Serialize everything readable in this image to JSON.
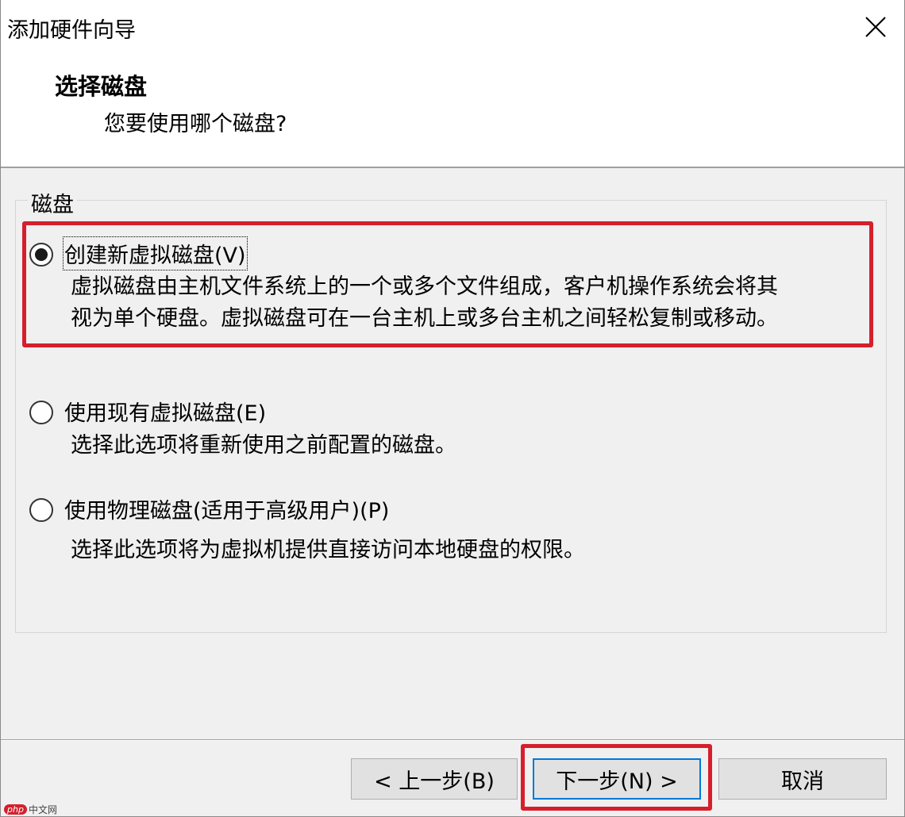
{
  "window": {
    "title": "添加硬件向导"
  },
  "header": {
    "title": "选择磁盘",
    "subtitle": "您要使用哪个磁盘?"
  },
  "group": {
    "label": "磁盘"
  },
  "options": [
    {
      "label": "创建新虚拟磁盘(V)",
      "checked": true,
      "desc_lines": [
        "虚拟磁盘由主机文件系统上的一个或多个文件组成，客户机操作系统会将其",
        "视为单个硬盘。虚拟磁盘可在一台主机上或多台主机之间轻松复制或移动。"
      ]
    },
    {
      "label": "使用现有虚拟磁盘(E)",
      "checked": false,
      "desc_lines": [
        "选择此选项将重新使用之前配置的磁盘。"
      ]
    },
    {
      "label": "使用物理磁盘(适用于高级用户)(P)",
      "checked": false,
      "desc_lines": [
        "选择此选项将为虚拟机提供直接访问本地硬盘的权限。"
      ]
    }
  ],
  "buttons": {
    "back": "< 上一步(B)",
    "next": "下一步(N) >",
    "cancel": "取消"
  },
  "icons": {
    "close": "close-icon"
  },
  "colors": {
    "highlight": "#d51f2c",
    "default_button_border": "#0078d7",
    "dialog_bg": "#f0f0f0"
  },
  "watermark": {
    "badge": "php",
    "text": "中文网"
  }
}
